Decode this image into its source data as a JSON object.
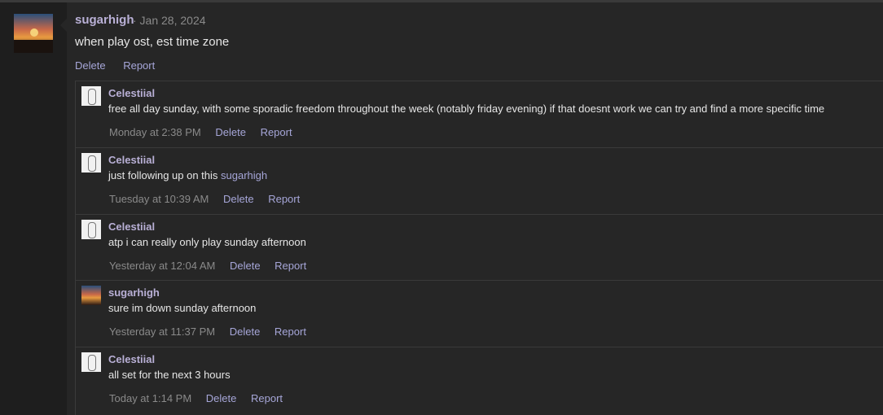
{
  "post": {
    "author": "sugarhigh",
    "date": "· Jan 28, 2024",
    "text": "when play ost, est time zone",
    "delete_label": "Delete",
    "report_label": "Report"
  },
  "replies": [
    {
      "author": "Celestiial",
      "avatar": "sketch-avatar",
      "text": "free all day sunday, with some sporadic freedom throughout the week (notably friday evening) if that doesnt work we can try and find a more specific time",
      "mention": "",
      "time": "Monday at 2:38 PM",
      "delete_label": "Delete",
      "report_label": "Report"
    },
    {
      "author": "Celestiial",
      "avatar": "sketch-avatar",
      "text": "just following up on this ",
      "mention": "sugarhigh",
      "time": "Tuesday at 10:39 AM",
      "delete_label": "Delete",
      "report_label": "Report"
    },
    {
      "author": "Celestiial",
      "avatar": "sketch-avatar",
      "text": "atp i can really only play sunday afternoon",
      "mention": "",
      "time": "Yesterday at 12:04 AM",
      "delete_label": "Delete",
      "report_label": "Report"
    },
    {
      "author": "sugarhigh",
      "avatar": "sunset-avatar",
      "text": "sure im down sunday afternoon",
      "mention": "",
      "time": "Yesterday at 11:37 PM",
      "delete_label": "Delete",
      "report_label": "Report"
    },
    {
      "author": "Celestiial",
      "avatar": "sketch-avatar",
      "text": "all set for the next 3 hours",
      "mention": "",
      "time": "Today at 1:14 PM",
      "delete_label": "Delete",
      "report_label": "Report"
    }
  ],
  "colors": {
    "background": "#1b1b1b",
    "panel": "#262626",
    "username": "#b9b0d6",
    "link": "#a6a6d8",
    "muted": "#8a8a8a",
    "text": "#e6e6e6"
  }
}
